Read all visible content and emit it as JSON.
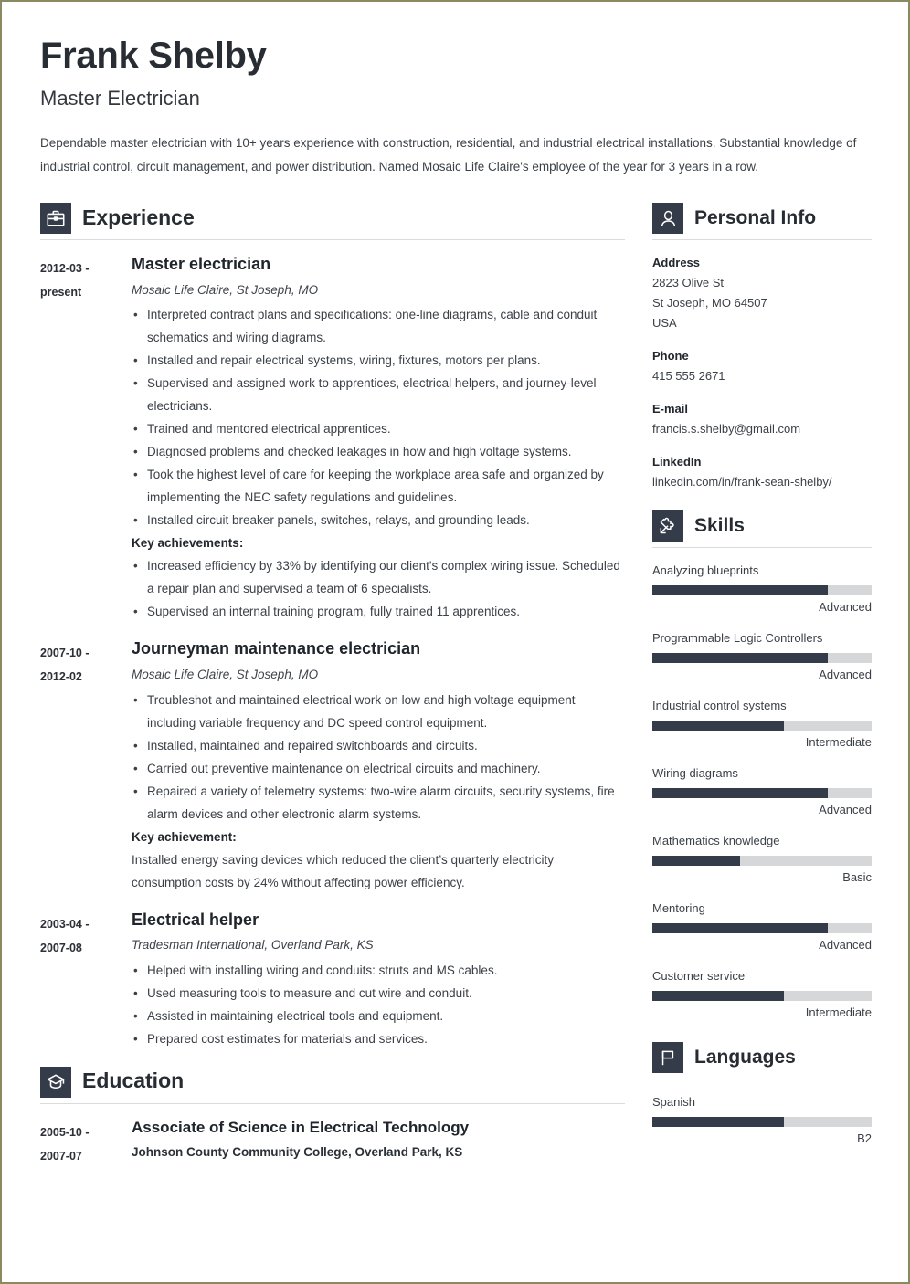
{
  "header": {
    "name": "Frank Shelby",
    "job_title": "Master Electrician",
    "summary": "Dependable master electrician with 10+ years experience with construction, residential, and industrial electrical installations. Substantial knowledge of industrial control, circuit management, and power distribution. Named Mosaic Life Claire's employee of the year for 3 years in a row."
  },
  "colors": {
    "accent_dark": "#343b49",
    "text": "#3c4148",
    "heading": "#272c33",
    "bar_track": "#d5d7d8",
    "page_border": "#8a8a62"
  },
  "experience": {
    "title": "Experience",
    "icon": "briefcase-icon",
    "entries": [
      {
        "date_from": "2012-03 -",
        "date_to": "present",
        "role": "Master electrician",
        "org": "Mosaic Life Claire, St Joseph, MO",
        "bullets": [
          "Interpreted contract plans and specifications: one-line diagrams, cable and conduit schematics and wiring diagrams.",
          "Installed and repair electrical systems, wiring, fixtures, motors per plans.",
          "Supervised and assigned work to apprentices, electrical helpers, and journey-level electricians.",
          "Trained and mentored electrical apprentices.",
          "Diagnosed problems and checked leakages in how and high voltage systems.",
          "Took the highest level of care for keeping the workplace area safe and organized by implementing the NEC safety regulations and guidelines.",
          "Installed circuit breaker panels, switches, relays, and grounding leads."
        ],
        "key_label": "Key achievements:",
        "key_bullets": [
          "Increased efficiency by 33% by identifying our client's complex wiring issue. Scheduled a repair plan and supervised a team of 6 specialists.",
          "Supervised an internal training program, fully trained 11 apprentices."
        ],
        "key_text": ""
      },
      {
        "date_from": "2007-10 -",
        "date_to": "2012-02",
        "role": "Journeyman maintenance electrician",
        "org": "Mosaic Life Claire, St Joseph, MO",
        "bullets": [
          "Troubleshot and maintained electrical work on low and high voltage equipment including variable frequency and DC speed control equipment.",
          "Installed, maintained and repaired switchboards and circuits.",
          "Carried out preventive maintenance on electrical circuits and machinery.",
          "Repaired a variety of telemetry systems: two-wire alarm circuits, security systems, fire alarm devices and other electronic alarm systems."
        ],
        "key_label": "Key achievement:",
        "key_bullets": [],
        "key_text": "Installed energy saving devices which reduced the client’s quarterly electricity consumption costs by 24% without affecting power efficiency."
      },
      {
        "date_from": "2003-04 -",
        "date_to": "2007-08",
        "role": "Electrical helper",
        "org": "Tradesman International, Overland Park, KS",
        "bullets": [
          "Helped with installing wiring and conduits: struts and MS cables.",
          "Used measuring tools to measure and cut wire and conduit.",
          "Assisted in maintaining electrical tools and equipment.",
          "Prepared cost estimates for materials and services."
        ],
        "key_label": "",
        "key_bullets": [],
        "key_text": ""
      }
    ]
  },
  "education": {
    "title": "Education",
    "icon": "graduation-cap-icon",
    "entries": [
      {
        "date_from": "2005-10 -",
        "date_to": "2007-07",
        "degree": "Associate of Science in Electrical Technology",
        "school": "Johnson County Community College, Overland Park, KS"
      }
    ]
  },
  "personal_info": {
    "title": "Personal Info",
    "icon": "person-icon",
    "blocks": [
      {
        "label": "Address",
        "lines": [
          "2823 Olive St",
          "St Joseph, MO 64507",
          "USA"
        ]
      },
      {
        "label": "Phone",
        "lines": [
          "415 555 2671"
        ]
      },
      {
        "label": "E-mail",
        "lines": [
          "francis.s.shelby@gmail.com"
        ]
      },
      {
        "label": "LinkedIn",
        "lines": [
          "linkedin.com/in/frank-sean-shelby/"
        ]
      }
    ]
  },
  "skills": {
    "title": "Skills",
    "icon": "puzzle-piece-icon",
    "items": [
      {
        "name": "Analyzing blueprints",
        "level": "Advanced",
        "percent": 80
      },
      {
        "name": "Programmable Logic Controllers",
        "level": "Advanced",
        "percent": 80
      },
      {
        "name": "Industrial control systems",
        "level": "Intermediate",
        "percent": 60
      },
      {
        "name": "Wiring diagrams",
        "level": "Advanced",
        "percent": 80
      },
      {
        "name": "Mathematics knowledge",
        "level": "Basic",
        "percent": 40
      },
      {
        "name": "Mentoring",
        "level": "Advanced",
        "percent": 80
      },
      {
        "name": "Customer service",
        "level": "Intermediate",
        "percent": 60
      }
    ]
  },
  "languages": {
    "title": "Languages",
    "icon": "flag-icon",
    "items": [
      {
        "name": "Spanish",
        "level": "B2",
        "percent": 60
      }
    ]
  }
}
